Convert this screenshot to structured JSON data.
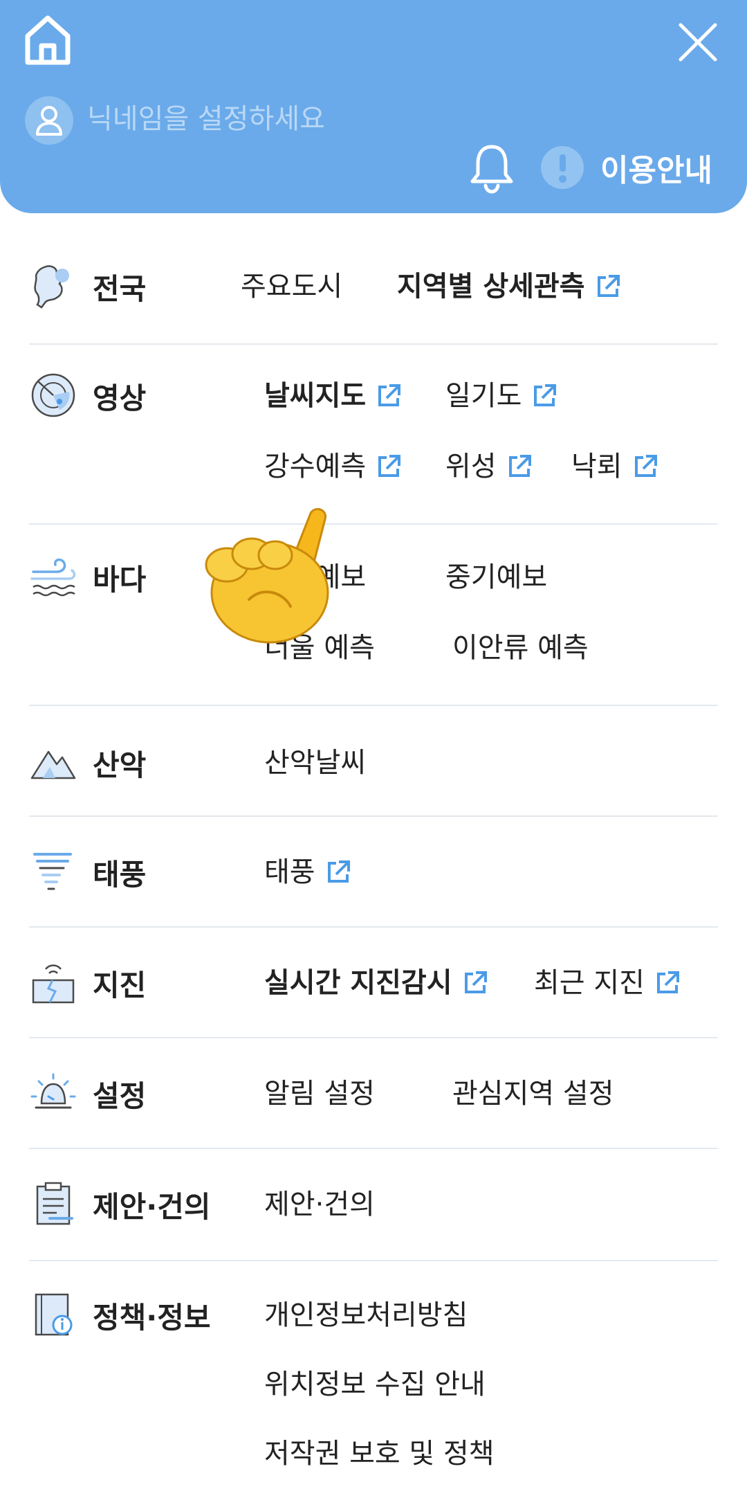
{
  "header": {
    "nickname_placeholder": "닉네임을 설정하세요",
    "info_label": "이용안내",
    "icons": [
      "home-icon",
      "close-icon",
      "user-icon",
      "bell-icon",
      "exclamation-icon"
    ]
  },
  "colors": {
    "header_bg": "#6aaaea",
    "accent_icon": "#4a9be6",
    "divider": "#e4e9ee"
  },
  "menu": {
    "national": {
      "label": "전국",
      "links": [
        "주요도시",
        "지역별 상세관측"
      ]
    },
    "imagery": {
      "label": "영상",
      "links": [
        "날씨지도",
        "일기도",
        "강수예측",
        "위성",
        "낙뢰"
      ]
    },
    "sea": {
      "label": "바다",
      "links": [
        "단기예보",
        "중기예보",
        "너울 예측",
        "이안류 예측"
      ]
    },
    "mountain": {
      "label": "산악",
      "links": [
        "산악날씨"
      ]
    },
    "typhoon": {
      "label": "태풍",
      "links": [
        "태풍"
      ]
    },
    "earthquake": {
      "label": "지진",
      "links": [
        "실시간 지진감시",
        "최근 지진"
      ]
    },
    "settings": {
      "label": "설정",
      "links": [
        "알림 설정",
        "관심지역 설정"
      ]
    },
    "suggestion": {
      "label": "제안·건의",
      "links": [
        "제안·건의"
      ]
    },
    "policy": {
      "label": "정책·정보",
      "links": [
        "개인정보처리방침",
        "위치정보 수집 안내",
        "저작권 보호 및 정책"
      ]
    }
  }
}
